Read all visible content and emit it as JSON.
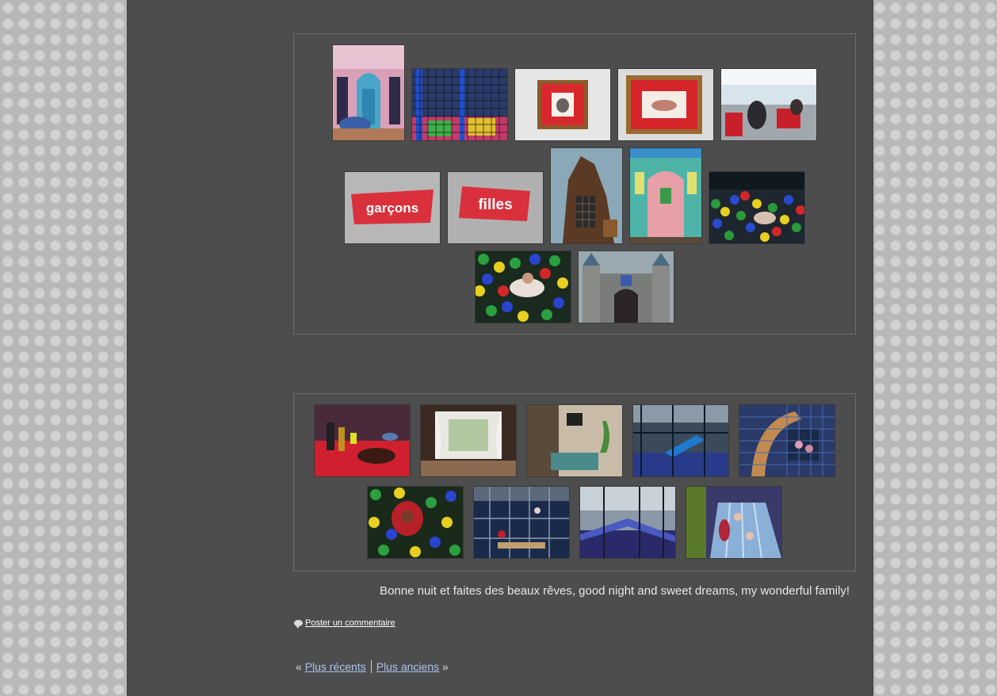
{
  "caption": "Bonne nuit et faites des beaux rêves, good night and sweet dreams, my wonderful family!",
  "comment": {
    "label": "Poster un commentaire",
    "icon": "speech-bubble-icon"
  },
  "pager": {
    "left_arrow": "«",
    "newer": "Plus récents",
    "older": "Plus anciens",
    "right_arrow": "»"
  },
  "signs": {
    "boys": "garçons",
    "girls": "filles"
  },
  "colors": {
    "panel": "#4d4d4d",
    "link": "#a9c4ea",
    "caption": "#e8e8e8",
    "sign_red": "#d9303c"
  }
}
